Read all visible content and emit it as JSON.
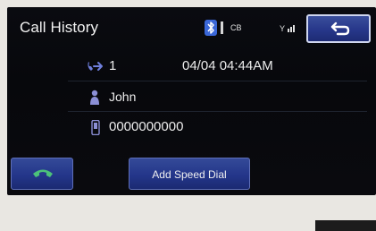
{
  "header": {
    "title": "Call History",
    "battery_text": "CB"
  },
  "entry": {
    "direction_icon": "outgoing-call-icon",
    "count": "1",
    "datetime": "04/04 04:44AM",
    "contact_icon": "person-icon",
    "name": "John",
    "phone_icon": "mobile-phone-icon",
    "number": "0000000000"
  },
  "actions": {
    "call_icon": "handset-call-icon",
    "add_speed_dial_label": "Add Speed Dial",
    "back_icon": "return-arrow-icon"
  },
  "colors": {
    "accent_blue": "#27378a",
    "call_green": "#4cc17a",
    "phone_icon_purple": "#8b8fd6"
  }
}
